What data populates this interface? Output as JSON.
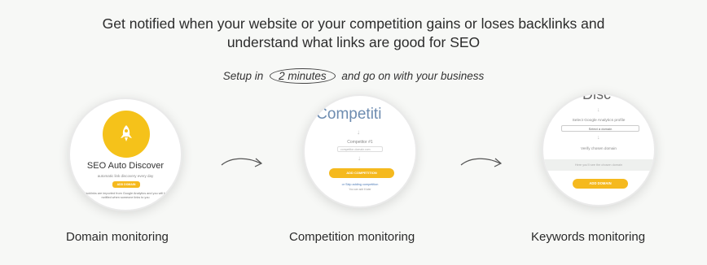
{
  "headline": {
    "line1": "Get notified when your website or your competition gains or loses backlinks and",
    "line2": "understand what links are good for SEO"
  },
  "setup": {
    "prefix": "Setup in",
    "highlight": "2 minutes",
    "suffix": "and go on with your business"
  },
  "features": [
    {
      "label": "Domain monitoring",
      "preview": {
        "icon": "rocket-icon",
        "title": "SEO Auto Discover",
        "subtitle": "automatic link discovery every day",
        "button": "ADD DOMAIN",
        "note": "Backlinks are imported from Google Analytics and you will be notified when someone links to you"
      }
    },
    {
      "label": "Competition monitoring",
      "preview": {
        "title": "ur Competiti",
        "field_label": "Competitor #1",
        "field_value": "competitor-domain.com",
        "button": "ADD COMPETITION",
        "link": "or Skip adding competition",
        "link_note": "You can add it later"
      }
    },
    {
      "label": "Keywords monitoring",
      "preview": {
        "title": "uto Disc",
        "select_label": "Select Google Analytics profile",
        "select_value": "Select a domain",
        "verify_label": "Verify chosen domain",
        "band_text": "Here you'll see the chosen domain",
        "button": "ADD DOMAIN"
      }
    }
  ],
  "colors": {
    "background": "#f7f8f6",
    "accent_yellow": "#f5c21a",
    "button_yellow": "#f5b91e",
    "title_blue": "#6d8cb0"
  }
}
